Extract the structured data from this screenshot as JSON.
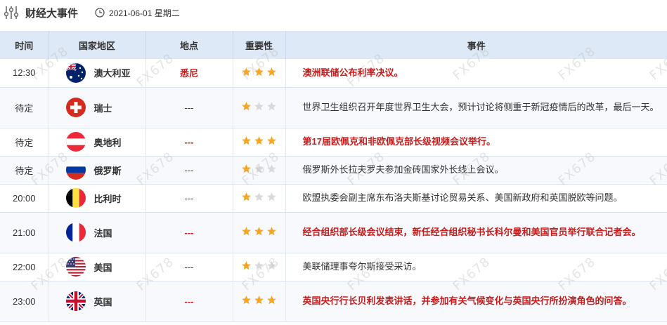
{
  "header": {
    "title": "财经大事件",
    "date": "2021-06-01 星期二"
  },
  "columns": {
    "time": "时间",
    "country": "国家地区",
    "place": "地点",
    "importance": "重要性",
    "event": "事件"
  },
  "rows": [
    {
      "time": "12:30",
      "country": "澳大利亚",
      "flag": "australia-flag-icon",
      "place": "悉尼",
      "stars": 3,
      "event": "澳洲联储公布利率决议。",
      "important": true
    },
    {
      "time": "待定",
      "country": "瑞士",
      "flag": "switzerland-flag-icon",
      "place": "---",
      "stars": 1,
      "event": "世界卫生组织召开年度世界卫生大会，预计讨论将侧重于新冠疫情后的改革，最后一天。",
      "important": false
    },
    {
      "time": "待定",
      "country": "奥地利",
      "flag": "austria-flag-icon",
      "place": "---",
      "stars": 3,
      "event": "第17届欧佩克和非欧佩克部长级视频会议举行。",
      "important": true
    },
    {
      "time": "待定",
      "country": "俄罗斯",
      "flag": "russia-flag-icon",
      "place": "---",
      "stars": 1,
      "event": "俄罗斯外长拉夫罗夫参加金砖国家外长线上会议。",
      "important": false
    },
    {
      "time": "20:00",
      "country": "比利时",
      "flag": "belgium-flag-icon",
      "place": "---",
      "stars": 1,
      "event": "欧盟执委会副主席东布洛夫斯基讨论贸易关系、美国新政府和英国脱欧等问题。",
      "important": false
    },
    {
      "time": "21:00",
      "country": "法国",
      "flag": "france-flag-icon",
      "place": "---",
      "stars": 3,
      "event": "经合组织部长级会议结束，新任经合组织秘书长科尔曼和美国官员举行联合记者会。",
      "important": true
    },
    {
      "time": "22:00",
      "country": "美国",
      "flag": "usa-flag-icon",
      "place": "---",
      "stars": 1,
      "event": "美联储理事夸尔斯接受采访。",
      "important": false
    },
    {
      "time": "23:00",
      "country": "英国",
      "flag": "uk-flag-icon",
      "place": "---",
      "stars": 3,
      "event": "英国央行行长贝利发表讲话，并参加有关气候变化与英国央行所扮演角色的问答。",
      "important": true
    }
  ],
  "watermark": "FX678",
  "colors": {
    "header_bg": "#dde9f7",
    "important_text": "#c61c1c",
    "star_on": "#f5a623",
    "star_off": "#d9d9d9"
  }
}
